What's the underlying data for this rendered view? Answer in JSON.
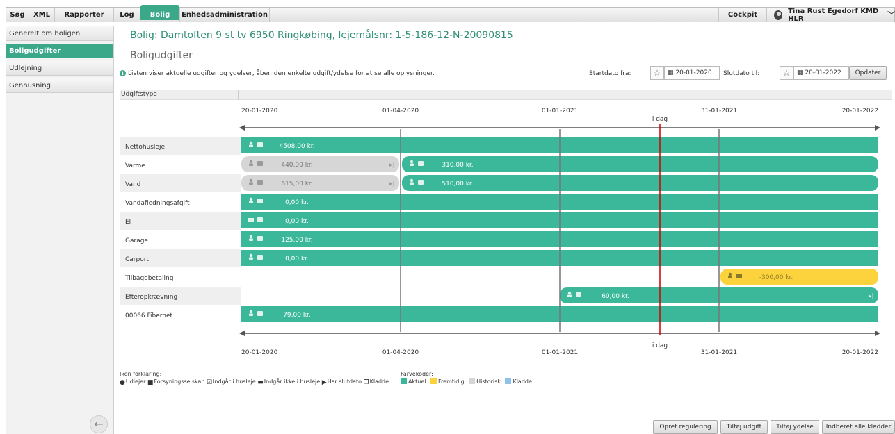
{
  "topnav": {
    "tabs": [
      "Søg",
      "XML",
      "Rapporter",
      "Log",
      "Bolig",
      "Enhedsadministration"
    ],
    "active": "Bolig",
    "cockpit": "Cockpit",
    "user": "Tina Rust Egedorf KMD HLR"
  },
  "sidebar": {
    "items": [
      "Generelt om boligen",
      "Boligudgifter",
      "Udlejning",
      "Genhusning"
    ],
    "active": "Boligudgifter"
  },
  "page": {
    "title": "Bolig: Damtoften 9 st tv 6950 Ringkøbing, lejemålsnr: 1-5-186-12-N-20090815",
    "section": "Boligudgifter",
    "info": "Listen viser aktuelle udgifter og ydelser, åben den enkelte udgift/ydelse for at se alle oplysninger."
  },
  "filters": {
    "start_label": "Startdato fra:",
    "start_date": "20-01-2020",
    "end_label": "Slutdato til:",
    "end_date": "20-01-2022",
    "update_button": "Opdater"
  },
  "table": {
    "column_header": "Udgiftstype"
  },
  "timeline": {
    "markers": [
      "20-01-2020",
      "01-04-2020",
      "01-01-2021",
      "31-01-2021",
      "20-01-2022"
    ],
    "today_label": "i dag",
    "rows": [
      {
        "label": "Nettohusleje",
        "bars": [
          {
            "amount": "4508,00 kr.",
            "status": "aktuel",
            "icon": "user"
          }
        ]
      },
      {
        "label": "Varme",
        "bars": [
          {
            "amount": "440,00 kr.",
            "status": "historisk",
            "icon": "user",
            "end": true
          },
          {
            "amount": "310,00 kr.",
            "status": "aktuel",
            "icon": "user"
          }
        ]
      },
      {
        "label": "Vand",
        "bars": [
          {
            "amount": "615,00 kr.",
            "status": "historisk",
            "icon": "user",
            "end": true
          },
          {
            "amount": "510,00 kr.",
            "status": "aktuel",
            "icon": "user"
          }
        ]
      },
      {
        "label": "Vandafledningsafgift",
        "bars": [
          {
            "amount": "0,00 kr.",
            "status": "aktuel",
            "icon": "user"
          }
        ]
      },
      {
        "label": "El",
        "bars": [
          {
            "amount": "0,00 kr.",
            "status": "aktuel",
            "icon": "factory"
          }
        ]
      },
      {
        "label": "Garage",
        "bars": [
          {
            "amount": "125,00 kr.",
            "status": "aktuel",
            "icon": "user"
          }
        ]
      },
      {
        "label": "Carport",
        "bars": [
          {
            "amount": "0,00 kr.",
            "status": "aktuel",
            "icon": "user"
          }
        ]
      },
      {
        "label": "Tilbagebetaling",
        "bars": [
          {
            "amount": "-300,00 kr.",
            "status": "fremtidig",
            "icon": "user"
          }
        ]
      },
      {
        "label": "Efteropkrævning",
        "bars": [
          {
            "amount": "60,00 kr.",
            "status": "aktuel",
            "icon": "user",
            "end": true
          }
        ]
      },
      {
        "label": "00066 Fibernet",
        "bars": [
          {
            "amount": "79,00 kr.",
            "status": "aktuel",
            "icon": "user"
          }
        ]
      }
    ]
  },
  "legend": {
    "icons_title": "Ikon forklaring:",
    "icons": [
      "Udlejer",
      "Forsyningsselskab",
      "Indgår i husleje",
      "Indgår ikke i husleje",
      "Har slutdato",
      "Kladde"
    ],
    "colors_title": "Farvekoder:",
    "colors": [
      {
        "label": "Aktuel",
        "color": "#3bb89a"
      },
      {
        "label": "Fremtidig",
        "color": "#fcd33c"
      },
      {
        "label": "Historisk",
        "color": "#d6d6d6"
      },
      {
        "label": "Kladde",
        "color": "#8ec2ea"
      }
    ]
  },
  "actions": [
    "Opret regulering",
    "Tilføj udgift",
    "Tilføj ydelse",
    "Indberet alle kladder"
  ],
  "colors": {
    "accent": "#3ba88a",
    "today_line": "#cc0000"
  }
}
